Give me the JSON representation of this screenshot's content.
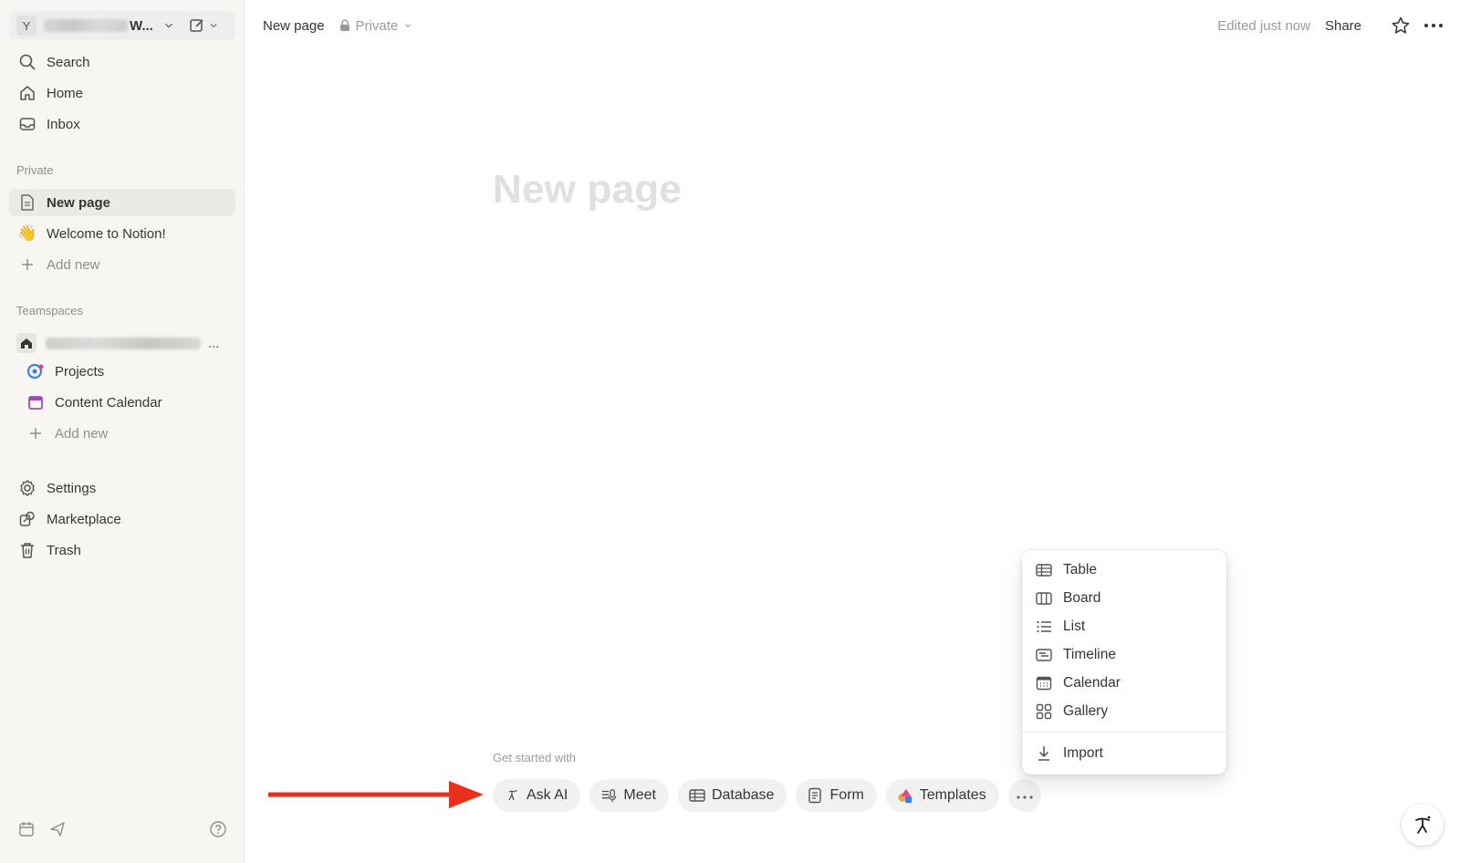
{
  "sidebar": {
    "workspace": {
      "avatar_letter": "Y",
      "name": "W..."
    },
    "nav": [
      {
        "label": "Search",
        "icon": "search-icon"
      },
      {
        "label": "Home",
        "icon": "home-icon"
      },
      {
        "label": "Inbox",
        "icon": "inbox-icon"
      }
    ],
    "private_label": "Private",
    "private_pages": [
      {
        "label": "New page",
        "icon": "page-icon"
      },
      {
        "label": "Welcome to Notion!",
        "icon": "waving-hand-icon"
      },
      {
        "label": "Add new",
        "icon": "plus-icon"
      }
    ],
    "teamspaces_label": "Teamspaces",
    "teamspace_more": "...",
    "teamspace_pages": [
      {
        "label": "Projects",
        "icon": "projects-icon"
      },
      {
        "label": "Content Calendar",
        "icon": "calendar-icon"
      },
      {
        "label": "Add new",
        "icon": "plus-icon"
      }
    ],
    "footer_nav": [
      {
        "label": "Settings",
        "icon": "gear-icon"
      },
      {
        "label": "Marketplace",
        "icon": "marketplace-icon"
      },
      {
        "label": "Trash",
        "icon": "trash-icon"
      }
    ]
  },
  "topbar": {
    "breadcrumb": "New page",
    "privacy": "Private",
    "edited": "Edited just now",
    "share": "Share"
  },
  "main": {
    "title_placeholder": "New page",
    "get_started": "Get started with",
    "chips": [
      {
        "label": "Ask AI",
        "icon": "ai-icon"
      },
      {
        "label": "Meet",
        "icon": "meet-icon"
      },
      {
        "label": "Database",
        "icon": "table-icon"
      },
      {
        "label": "Form",
        "icon": "form-icon"
      },
      {
        "label": "Templates",
        "icon": "templates-icon"
      }
    ]
  },
  "menu": {
    "items": [
      {
        "label": "Table",
        "icon": "table-icon"
      },
      {
        "label": "Board",
        "icon": "board-icon"
      },
      {
        "label": "List",
        "icon": "list-icon"
      },
      {
        "label": "Timeline",
        "icon": "timeline-icon"
      },
      {
        "label": "Calendar",
        "icon": "calendar-icon"
      },
      {
        "label": "Gallery",
        "icon": "gallery-icon"
      }
    ],
    "import": {
      "label": "Import",
      "icon": "import-icon"
    }
  },
  "colors": {
    "sidebar_bg": "#f7f6f3",
    "text": "#37352f",
    "muted": "#9b9a97",
    "chip_bg": "#f1f1ef",
    "annotation_arrow": "#e8301c"
  }
}
